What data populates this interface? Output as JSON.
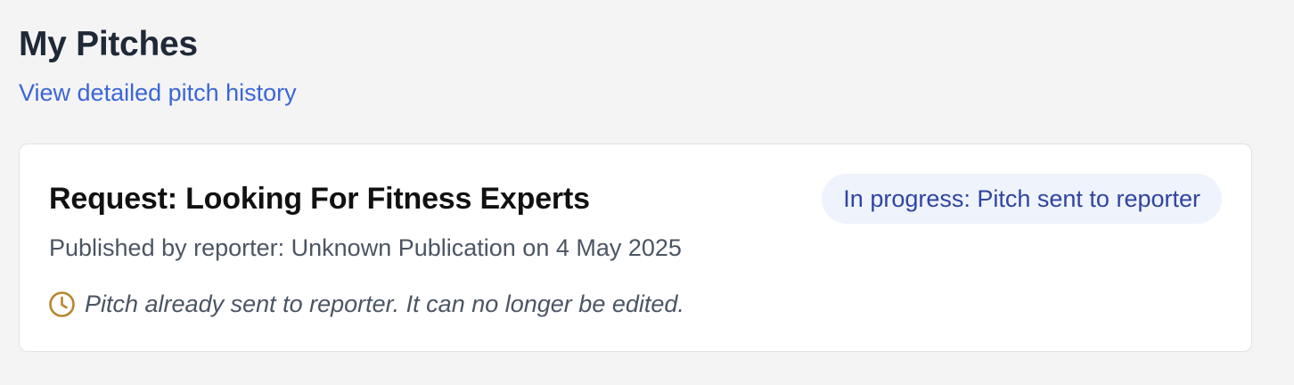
{
  "header": {
    "title": "My Pitches",
    "history_link": "View detailed pitch history"
  },
  "pitch": {
    "title": "Request: Looking For Fitness Experts",
    "status": "In progress: Pitch sent to reporter",
    "meta": "Published by reporter: Unknown Publication on 4 May 2025",
    "notice": "Pitch already sent to reporter. It can no longer be edited.",
    "notice_icon": "clock-icon"
  },
  "colors": {
    "link": "#3b66d6",
    "badge_bg": "#eef3fc",
    "badge_text": "#2f45a0",
    "notice_icon": "#b8862e"
  }
}
